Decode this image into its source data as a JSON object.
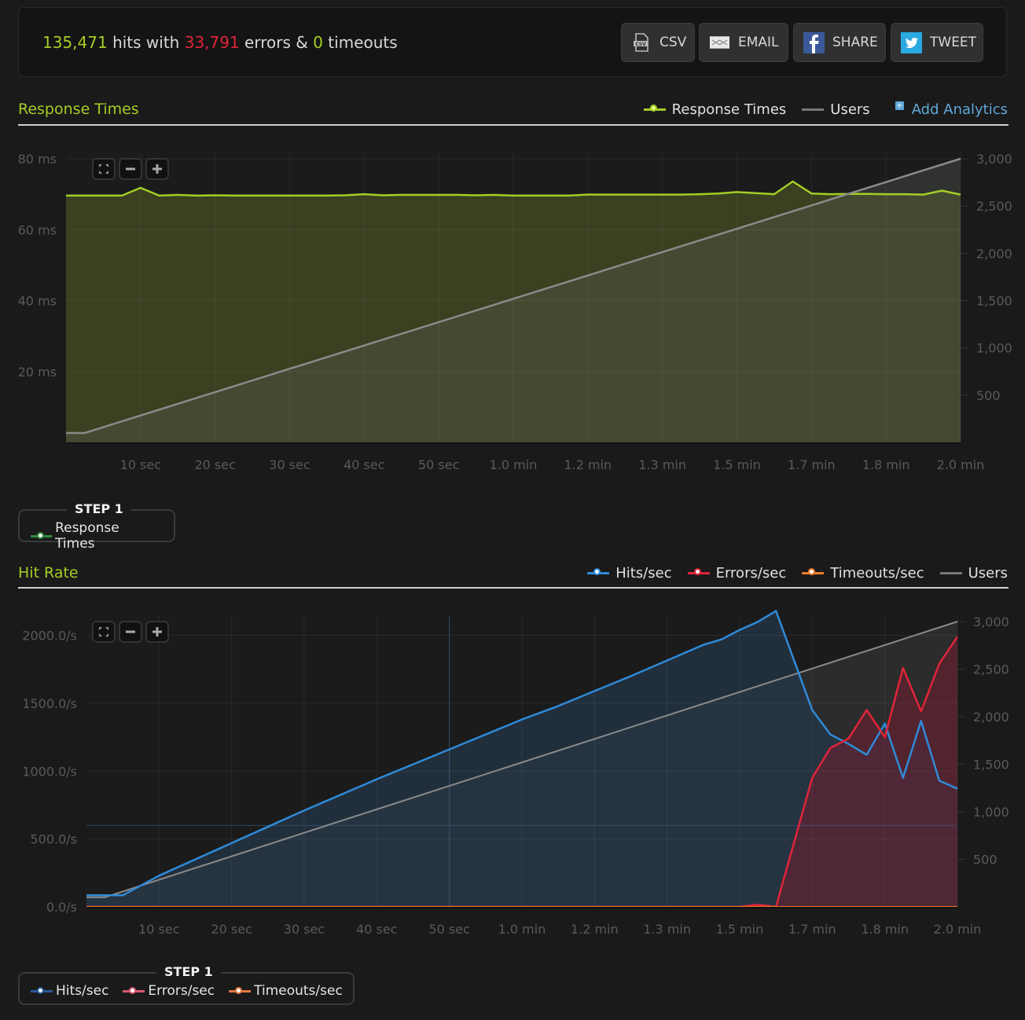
{
  "summary": {
    "hits": "135,471",
    "hits_text": " hits with ",
    "errors": "33,791",
    "errors_text": " errors & ",
    "timeouts": "0",
    "timeouts_text": " timeouts"
  },
  "actions": [
    {
      "label": "CSV",
      "icon": "csv-file-icon"
    },
    {
      "label": "EMAIL",
      "icon": "envelope-icon"
    },
    {
      "label": "SHARE",
      "icon": "facebook-icon"
    },
    {
      "label": "TWEET",
      "icon": "twitter-icon"
    }
  ],
  "colors": {
    "accent_green": "#a4cd26",
    "error_red": "#e0243a",
    "hits_blue": "#2f8ad8",
    "timeouts_orange": "#f07a2a",
    "users_gray": "#8a8a8a",
    "link_blue": "#5ea8d8"
  },
  "zoom_controls": {
    "reset": "fit-icon",
    "zoom_out": "minus-icon",
    "zoom_in": "plus-icon"
  },
  "response_section": {
    "title": "Response Times",
    "legend": [
      "Response Times",
      "Users"
    ],
    "add_analytics": "Add Analytics",
    "step_title": "STEP 1",
    "step_items": [
      "Response Times"
    ]
  },
  "hitrate_section": {
    "title": "Hit Rate",
    "legend": [
      "Hits/sec",
      "Errors/sec",
      "Timeouts/sec",
      "Users"
    ],
    "step_title": "STEP 1",
    "step_items": [
      "Hits/sec",
      "Errors/sec",
      "Timeouts/sec"
    ]
  },
  "chart_data": [
    {
      "type": "area",
      "title": "Response Times",
      "xlabel": "",
      "ylabel": "",
      "x_unit": "seconds",
      "xlim": [
        0,
        120
      ],
      "x_ticks": [
        10,
        20,
        30,
        40,
        50,
        60,
        70,
        80,
        90,
        100,
        110,
        120
      ],
      "x_tick_labels": [
        "10 sec",
        "20 sec",
        "30 sec",
        "40 sec",
        "50 sec",
        "1.0 min",
        "1.2 min",
        "1.3 min",
        "1.5 min",
        "1.7 min",
        "1.8 min",
        "2.0 min"
      ],
      "ylim": [
        0,
        80
      ],
      "y_ticks": [
        20,
        40,
        60,
        80
      ],
      "y_tick_labels": [
        "20 ms",
        "40 ms",
        "60 ms",
        "80 ms"
      ],
      "y2lim": [
        0,
        3000
      ],
      "y2_ticks": [
        500,
        1000,
        1500,
        2000,
        2500,
        3000
      ],
      "y2_tick_labels": [
        "500",
        "1,000",
        "1,500",
        "2,000",
        "2,500",
        "3,000"
      ],
      "grid": true,
      "legend_position": "top-right",
      "series": [
        {
          "name": "Response Times",
          "axis": "left",
          "x": [
            0,
            2.5,
            5,
            7.5,
            10,
            12.5,
            15,
            17.5,
            20,
            22.5,
            25,
            27.5,
            30,
            32.5,
            35,
            37.5,
            40,
            42.5,
            45,
            47.5,
            50,
            52.5,
            55,
            57.5,
            60,
            62.5,
            65,
            67.5,
            70,
            72.5,
            75,
            77.5,
            80,
            82.5,
            85,
            87.5,
            90,
            92.5,
            95,
            97.5,
            100,
            102.5,
            105,
            107.5,
            110,
            112.5,
            115,
            117.5,
            120
          ],
          "values": [
            69.6,
            69.6,
            69.6,
            69.6,
            71.8,
            69.6,
            69.8,
            69.6,
            69.7,
            69.6,
            69.6,
            69.6,
            69.6,
            69.6,
            69.6,
            69.7,
            70.0,
            69.7,
            69.8,
            69.8,
            69.8,
            69.8,
            69.7,
            69.8,
            69.6,
            69.6,
            69.6,
            69.6,
            69.9,
            69.9,
            69.9,
            69.9,
            69.9,
            69.9,
            70.0,
            70.2,
            70.6,
            70.3,
            70.0,
            73.6,
            70.2,
            70.0,
            70.1,
            70.1,
            70.0,
            70.0,
            69.9,
            71.0,
            69.9
          ]
        },
        {
          "name": "Users",
          "axis": "right",
          "x": [
            0,
            2.5,
            120
          ],
          "values": [
            100,
            100,
            3000
          ]
        }
      ]
    },
    {
      "type": "area",
      "title": "Hit Rate",
      "xlabel": "",
      "ylabel": "",
      "x_unit": "seconds",
      "xlim": [
        0,
        120
      ],
      "x_ticks": [
        10,
        20,
        30,
        40,
        50,
        60,
        70,
        80,
        90,
        100,
        110,
        120
      ],
      "x_tick_labels": [
        "10 sec",
        "20 sec",
        "30 sec",
        "40 sec",
        "50 sec",
        "1.0 min",
        "1.2 min",
        "1.3 min",
        "1.5 min",
        "1.7 min",
        "1.8 min",
        "2.0 min"
      ],
      "ylim": [
        0,
        2200
      ],
      "y_ticks": [
        0,
        500,
        1000,
        1500,
        2000
      ],
      "y_tick_labels": [
        "0.0/s",
        "500.0/s",
        "1000.0/s",
        "1500.0/s",
        "2000.0/s"
      ],
      "y2lim": [
        0,
        3000
      ],
      "y2_ticks": [
        500,
        1000,
        1500,
        2000,
        2500,
        3000
      ],
      "y2_tick_labels": [
        "500",
        "1,000",
        "1,500",
        "2,000",
        "2,500",
        "3,000"
      ],
      "grid": true,
      "legend_position": "top-right",
      "series": [
        {
          "name": "Hits/sec",
          "axis": "left",
          "x": [
            0,
            2.5,
            5,
            10,
            20,
            30,
            40,
            50,
            60,
            65,
            70,
            75,
            80,
            85,
            87.5,
            90,
            92.5,
            95,
            100,
            102.5,
            105,
            107.5,
            110,
            112.5,
            115,
            117.5,
            120
          ],
          "values": [
            85,
            85,
            85,
            230,
            470,
            710,
            940,
            1160,
            1380,
            1480,
            1590,
            1700,
            1815,
            1930,
            1970,
            2040,
            2100,
            2180,
            1450,
            1270,
            1200,
            1120,
            1350,
            950,
            1370,
            930,
            870
          ]
        },
        {
          "name": "Errors/sec",
          "axis": "left",
          "x": [
            0,
            90,
            92.5,
            95,
            100,
            102.5,
            105,
            107.5,
            110,
            112.5,
            115,
            117.5,
            120
          ],
          "values": [
            0,
            0,
            15,
            0,
            950,
            1170,
            1240,
            1450,
            1250,
            1760,
            1440,
            1790,
            1990
          ]
        },
        {
          "name": "Timeouts/sec",
          "axis": "left",
          "x": [
            0,
            120
          ],
          "values": [
            0,
            0
          ]
        },
        {
          "name": "Users",
          "axis": "right",
          "x": [
            0,
            2.5,
            120
          ],
          "values": [
            100,
            100,
            3000
          ]
        }
      ]
    }
  ]
}
